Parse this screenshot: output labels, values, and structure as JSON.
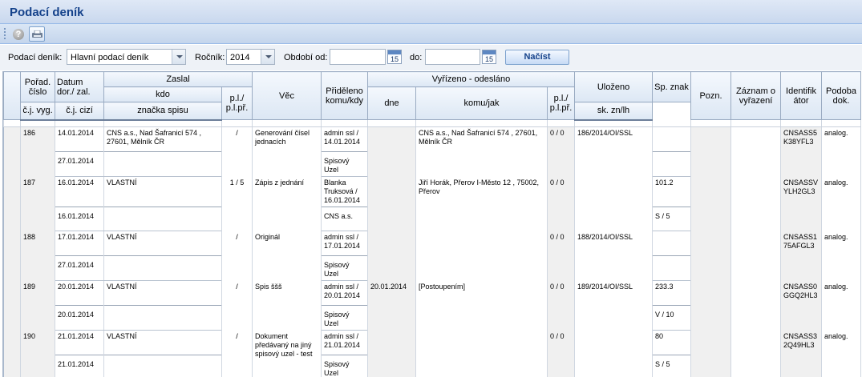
{
  "window": {
    "title": "Podací deník"
  },
  "toolbar": {
    "help_icon": "help-icon",
    "print_icon": "print-icon"
  },
  "filters": {
    "journal_label": "Podací deník:",
    "journal_value": "Hlavní podací deník",
    "year_label": "Ročník:",
    "year_value": "2014",
    "period_from_label": "Období od:",
    "period_from_value": "",
    "period_to_label": "do:",
    "period_to_value": "",
    "calendar_day": "15",
    "load_button": "Načíst"
  },
  "grid": {
    "headers": {
      "poradi": "Pořad. číslo",
      "datum": "Datum dor./ zal.",
      "cj_vyg": "č.j. vyg.",
      "zaslal": "Zaslal",
      "kdo": "kdo",
      "cj_cizi": "č.j. cizí",
      "pl": "p.l./ p.l.př.",
      "vec": "Věc",
      "prideleno": "Přiděleno komu/kdy",
      "vyrizeno": "Vyřízeno - odesláno",
      "dne": "dne",
      "komujak": "komu/jak",
      "pl2": "p.l./ p.l.př.",
      "ulozeno": "Uloženo",
      "znacka": "značka spisu",
      "spznak": "Sp. znak",
      "skzn": "sk. zn/lh",
      "pozn": "Pozn.",
      "zaznam": "Záznam o vyřazení",
      "ident": "Identifik átor",
      "podoba": "Podoba dok."
    },
    "rows": [
      {
        "poradi": "186",
        "datum": "14.01.2014",
        "datum2": "27.01.2014",
        "kdo": "CNS a.s., Nad Šafranicí 574 , 27601, Mělník ČR",
        "cj": "",
        "pl": "/",
        "vec": "Generování čísel jednacích",
        "prideleno": "admin ssl / 14.01.2014",
        "prideleno2": "Spisový Uzel",
        "dne": "",
        "komujak": "CNS a.s., Nad Šafranicí 574 , 27601, Mělník ČR",
        "pl2": "0 / 0",
        "ulozeno": "186/2014/OI/SSL",
        "spznak": "",
        "skzn": "",
        "pozn": "",
        "zaznam": "",
        "ident": "CNSASS5K38YFL3",
        "podoba": "analog."
      },
      {
        "poradi": "187",
        "datum": "16.01.2014",
        "datum2": "16.01.2014",
        "kdo": "VLASTNÍ",
        "cj": "",
        "pl": "1  /  5",
        "vec": "Zápis z jednání",
        "prideleno": "Blanka Truksová / 16.01.2014",
        "prideleno2": "CNS a.s.",
        "dne": "",
        "komujak": "Jiří Horák, Přerov I-Město 12 , 75002, Přerov",
        "pl2": "0 / 0",
        "ulozeno": "",
        "spznak": "101.2",
        "skzn": "S / 5",
        "pozn": "",
        "zaznam": "",
        "ident": "CNSASSVYLH2GL3",
        "podoba": "analog."
      },
      {
        "poradi": "188",
        "datum": "17.01.2014",
        "datum2": "27.01.2014",
        "kdo": "VLASTNÍ",
        "cj": "",
        "pl": "/",
        "vec": "Originál",
        "prideleno": "admin ssl / 17.01.2014",
        "prideleno2": "Spisový Uzel",
        "dne": "",
        "komujak": "",
        "pl2": "0 / 0",
        "ulozeno": "188/2014/OI/SSL",
        "spznak": "",
        "skzn": "",
        "pozn": "",
        "zaznam": "",
        "ident": "CNSASS175AFGL3",
        "podoba": "analog."
      },
      {
        "poradi": "189",
        "datum": "20.01.2014",
        "datum2": "20.01.2014",
        "kdo": "VLASTNÍ",
        "cj": "",
        "pl": "/",
        "vec": "Spis ššš",
        "prideleno": "admin ssl / 20.01.2014",
        "prideleno2": "Spisový Uzel",
        "dne": "20.01.2014",
        "komujak": "[Postoupením]",
        "pl2": "0 / 0",
        "ulozeno": "189/2014/OI/SSL",
        "spznak": "233.3",
        "skzn": "V / 10",
        "pozn": "",
        "zaznam": "",
        "ident": "CNSASS0GGQ2HL3",
        "podoba": "analog."
      },
      {
        "poradi": "190",
        "datum": "21.01.2014",
        "datum2": "21.01.2014",
        "kdo": "VLASTNÍ",
        "cj": "",
        "pl": "/",
        "vec": "Dokument předávaný na jiný spisový uzel - test",
        "prideleno": "admin ssl / 21.01.2014",
        "prideleno2": "Spisový Uzel",
        "dne": "",
        "komujak": "",
        "pl2": "0 / 0",
        "ulozeno": "",
        "spznak": "80",
        "skzn": "S / 5",
        "pozn": "",
        "zaznam": "",
        "ident": "CNSASS32Q49HL3",
        "podoba": "analog."
      }
    ]
  }
}
